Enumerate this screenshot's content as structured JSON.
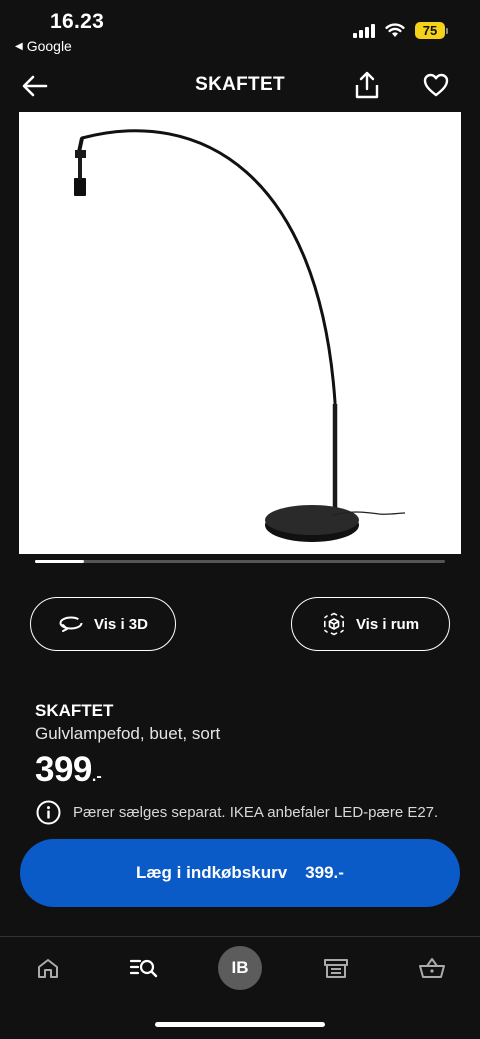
{
  "status_bar": {
    "time": "16.23",
    "back_app": "Google",
    "battery": "75"
  },
  "header": {
    "title": "SKAFTET",
    "icons": [
      "back-arrow-icon",
      "share-icon",
      "heart-icon"
    ]
  },
  "gallery": {
    "image": "floor lamp base, arched, black",
    "progress": 0.12
  },
  "actions": {
    "view_3d": "Vis i 3D",
    "view_room": "Vis i rum"
  },
  "product": {
    "name": "SKAFTET",
    "description": "Gulvlampefod, buet, sort",
    "price": "399",
    "price_suffix": ".-",
    "info": "Pærer sælges separat. IKEA anbefaler LED-pære E27."
  },
  "cart": {
    "label": "Læg i indkøbskurv",
    "price": "399.-",
    "color": "#0a5ac8"
  },
  "tab_bar": {
    "profile_initials": "IB",
    "icons": [
      "home-icon",
      "search-list-icon",
      "profile-avatar",
      "store-icon",
      "basket-icon"
    ]
  }
}
